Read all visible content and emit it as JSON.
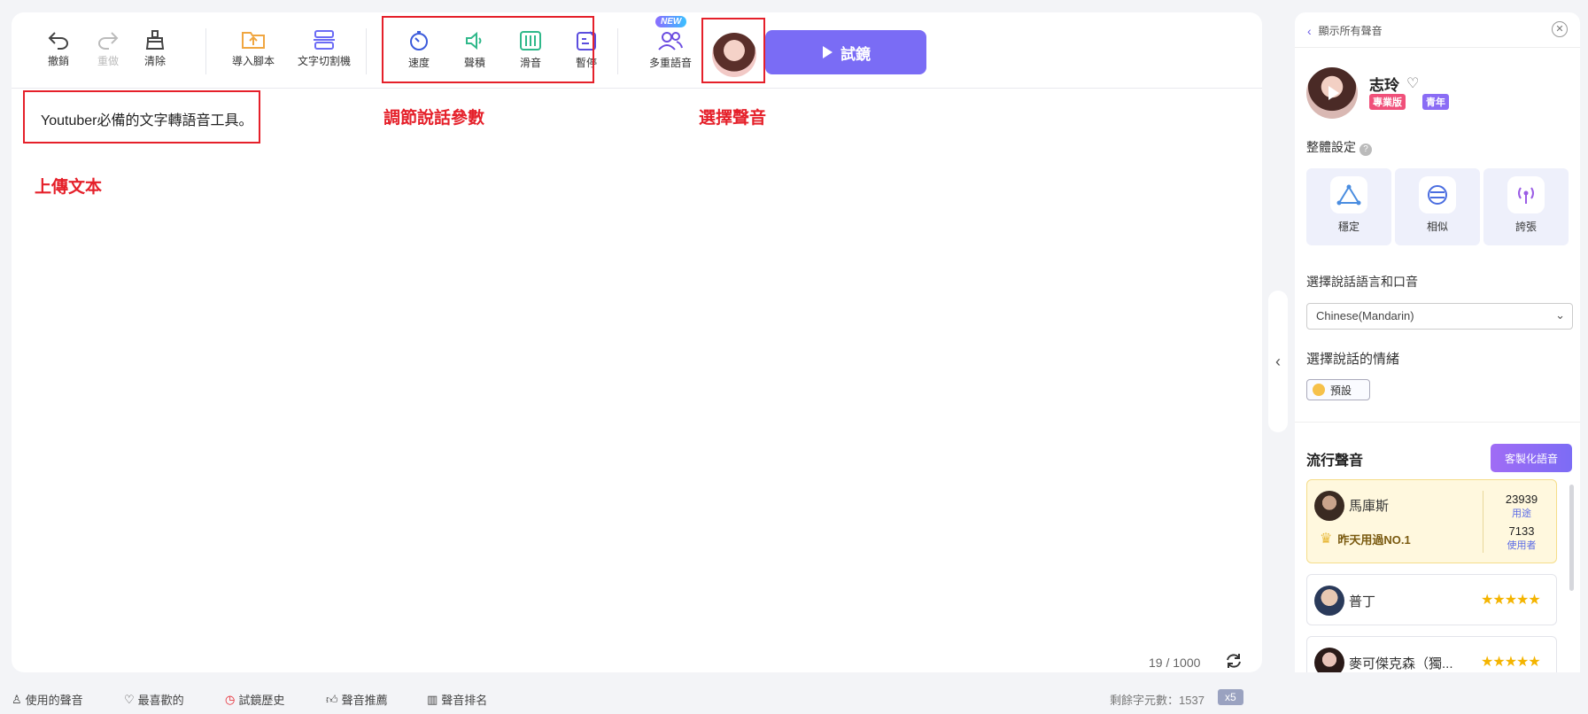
{
  "toolbar": {
    "undo": "撤銷",
    "redo": "重做",
    "clear": "清除",
    "import": "導入腳本",
    "split": "文字切割機",
    "speed": "速度",
    "volume": "聲積",
    "pitch": "滑音",
    "pause": "暫停",
    "multi": "多重語音",
    "new_badge": "NEW",
    "play": "試鏡"
  },
  "annotations": {
    "params": "調節說話參數",
    "voice": "選擇聲音",
    "upload": "上傳文本"
  },
  "editor": {
    "text": "Youtuber必備的文字轉語音工具。",
    "count": "19 / 1000"
  },
  "bottom": {
    "used": "使用的聲音",
    "favorites": "最喜歡的",
    "history": "試鏡歷史",
    "recommend": "聲音推薦",
    "ranking": "聲音排名",
    "remaining": "剩餘字元數：1537",
    "multiplier": "x5"
  },
  "panel": {
    "back": "顯示所有聲音",
    "voice_name": "志玲",
    "tag_pro": "專業版",
    "tag_age": "青年",
    "overall": "整體設定",
    "settings": [
      "穩定",
      "相似",
      "誇張"
    ],
    "lang_label": "選擇說話語言和口音",
    "lang_value": "Chinese(Mandarin)",
    "emotion_label": "選擇說話的情緒",
    "emotion_value": "預設",
    "popular": "流行聲音",
    "custom": "客製化語音",
    "voices": [
      {
        "name": "馬庫斯",
        "rank": "昨天用過NO.1",
        "uses": "23939",
        "uses_label": "用途",
        "users": "7133",
        "users_label": "使用者"
      },
      {
        "name": "普丁",
        "stars": "★★★★★"
      },
      {
        "name": "麥可傑克森（獨...",
        "stars": "★★★★★"
      }
    ]
  },
  "colors": {
    "accent": "#7a6cf5",
    "annotation": "#e5202a",
    "star": "#f4b400"
  }
}
